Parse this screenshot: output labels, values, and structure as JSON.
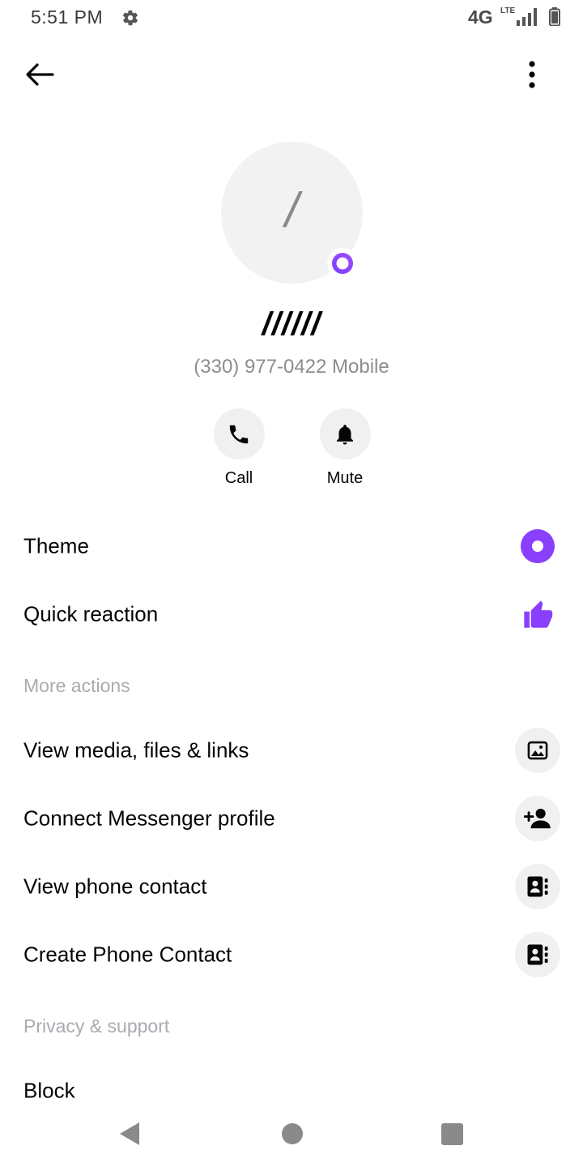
{
  "status_bar": {
    "time": "5:51 PM",
    "network": "4G",
    "network_sub": "LTE",
    "icons": [
      "gear-icon",
      "signal-icon",
      "battery-icon"
    ]
  },
  "header": {
    "back_icon": "arrow-left-icon",
    "more_icon": "more-vertical-icon"
  },
  "profile": {
    "avatar_letter": "/",
    "name": "//////",
    "phone": "(330) 977-0422 Mobile",
    "badge_icon": "messenger-badge-icon"
  },
  "actions": [
    {
      "label": "Call",
      "icon": "phone-icon"
    },
    {
      "label": "Mute",
      "icon": "bell-icon"
    }
  ],
  "settings": {
    "theme_label": "Theme",
    "quick_reaction_label": "Quick reaction"
  },
  "more_actions": {
    "header": "More actions",
    "items": [
      {
        "label": "View media, files & links",
        "icon": "image-icon"
      },
      {
        "label": "Connect Messenger profile",
        "icon": "add-person-icon"
      },
      {
        "label": "View phone contact",
        "icon": "contact-card-icon"
      },
      {
        "label": "Create Phone Contact",
        "icon": "contact-card-icon"
      }
    ]
  },
  "privacy": {
    "header": "Privacy & support",
    "block_label": "Block"
  },
  "colors": {
    "accent": "#8a3ffc",
    "text": "#050505",
    "secondary_text": "#8a8d91",
    "section_header": "#a8abaf",
    "icon_bg": "#f0f0f0"
  }
}
